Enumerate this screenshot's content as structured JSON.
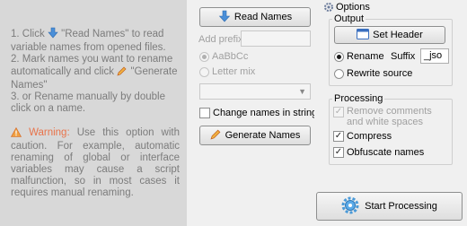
{
  "instructions": {
    "step1_pre": "1. Click",
    "step1_post": "\"Read Names\" to read variable names from opened files.",
    "step2_pre": "2. Mark names you want to rename automatically and click",
    "step2_post": "\"Generate Names\"",
    "step3": "3. or Rename manually by double click on a name.",
    "warning_label": "Warning:",
    "warning_text": "Use this option with caution. For example, automatic renaming of global or interface variables may cause a script malfunction, so in most cases it requires manual renaming."
  },
  "middle": {
    "read_names_label": "Read Names",
    "add_prefix_label": "Add prefix",
    "radio_aabbcc": "AaBbCc",
    "radio_letter_mix": "Letter mix",
    "change_names_label": "Change names in string",
    "generate_names_label": "Generate Names"
  },
  "options": {
    "title": "Options",
    "output_legend": "Output",
    "set_header_label": "Set Header",
    "rename_label": "Rename",
    "suffix_label": "Suffix",
    "suffix_value": "_jso",
    "rewrite_label": "Rewrite source",
    "processing_legend": "Processing",
    "remove_comments_label": "Remove comments and white spaces",
    "compress_label": "Compress",
    "obfuscate_label": "Obfuscate names"
  },
  "start_processing_label": "Start Processing",
  "colors": {
    "left_panel_bg": "#d8d8d8",
    "instruction_text": "#7c7c7c",
    "warning_accent": "#e8734a"
  }
}
